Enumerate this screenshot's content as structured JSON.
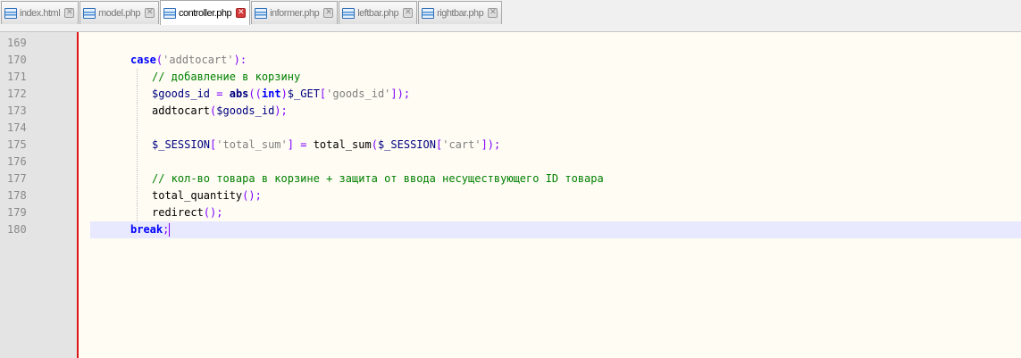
{
  "tabs": [
    {
      "label": "index.html",
      "active": false
    },
    {
      "label": "model.php",
      "active": false
    },
    {
      "label": "controller.php",
      "active": true
    },
    {
      "label": "informer.php",
      "active": false
    },
    {
      "label": "leftbar.php",
      "active": false
    },
    {
      "label": "rightbar.php",
      "active": false
    }
  ],
  "close_glyph": "✕",
  "lines": [
    {
      "n": "169",
      "indent": 0,
      "tokens": []
    },
    {
      "n": "170",
      "indent": 1,
      "tokens": [
        [
          "kw",
          "case"
        ],
        [
          "op",
          "("
        ],
        [
          "str",
          "'addtocart'"
        ],
        [
          "op",
          "):"
        ]
      ]
    },
    {
      "n": "171",
      "indent": 2,
      "tokens": [
        [
          "cm",
          "// добавление в корзину"
        ]
      ]
    },
    {
      "n": "172",
      "indent": 2,
      "tokens": [
        [
          "var",
          "$goods_id"
        ],
        [
          "plain",
          " "
        ],
        [
          "op",
          "="
        ],
        [
          "plain",
          " "
        ],
        [
          "fn",
          "abs"
        ],
        [
          "op",
          "(("
        ],
        [
          "kw",
          "int"
        ],
        [
          "op",
          ")"
        ],
        [
          "var",
          "$_GET"
        ],
        [
          "op",
          "["
        ],
        [
          "str",
          "'goods_id'"
        ],
        [
          "op",
          "]);"
        ]
      ]
    },
    {
      "n": "173",
      "indent": 2,
      "tokens": [
        [
          "plain",
          "addtocart"
        ],
        [
          "op",
          "("
        ],
        [
          "var",
          "$goods_id"
        ],
        [
          "op",
          ");"
        ]
      ]
    },
    {
      "n": "174",
      "indent": 2,
      "tokens": []
    },
    {
      "n": "175",
      "indent": 2,
      "tokens": [
        [
          "var",
          "$_SESSION"
        ],
        [
          "op",
          "["
        ],
        [
          "str",
          "'total_sum'"
        ],
        [
          "op",
          "]"
        ],
        [
          "plain",
          " "
        ],
        [
          "op",
          "="
        ],
        [
          "plain",
          " "
        ],
        [
          "plain",
          "total_sum"
        ],
        [
          "op",
          "("
        ],
        [
          "var",
          "$_SESSION"
        ],
        [
          "op",
          "["
        ],
        [
          "str",
          "'cart'"
        ],
        [
          "op",
          "]);"
        ]
      ]
    },
    {
      "n": "176",
      "indent": 2,
      "tokens": []
    },
    {
      "n": "177",
      "indent": 2,
      "tokens": [
        [
          "cm",
          "// кол-во товара в корзине + защита от ввода несуществующего ID товара"
        ]
      ]
    },
    {
      "n": "178",
      "indent": 2,
      "tokens": [
        [
          "plain",
          "total_quantity"
        ],
        [
          "op",
          "();"
        ]
      ]
    },
    {
      "n": "179",
      "indent": 2,
      "tokens": [
        [
          "plain",
          "redirect"
        ],
        [
          "op",
          "();"
        ]
      ]
    },
    {
      "n": "180",
      "indent": 1,
      "tokens": [
        [
          "kw",
          "break"
        ],
        [
          "op",
          ";"
        ]
      ],
      "current": true,
      "caret": true
    }
  ]
}
